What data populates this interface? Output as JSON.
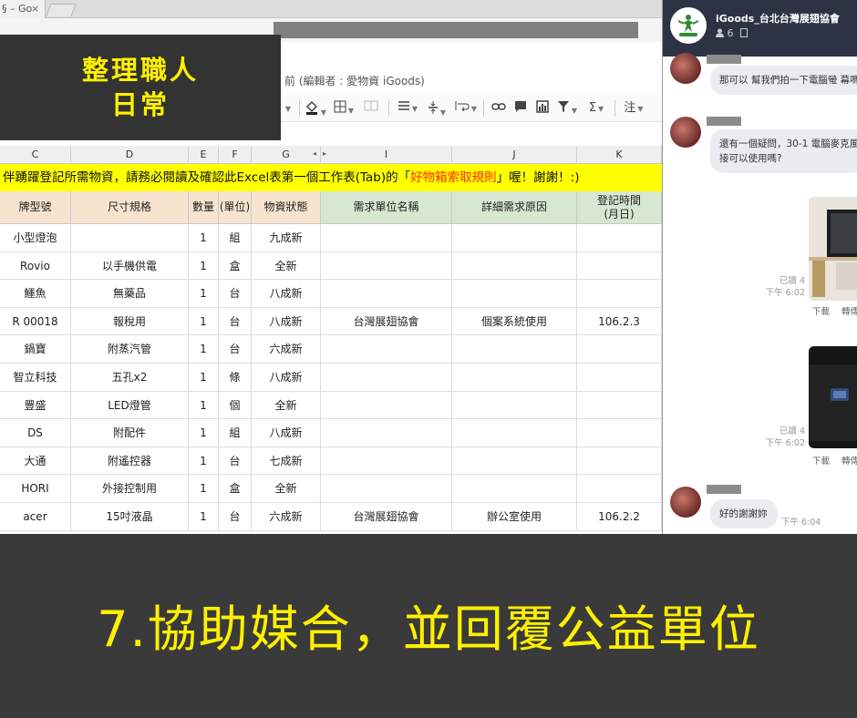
{
  "browser": {
    "tab_title": "§ – Go",
    "tab_close": "×"
  },
  "document": {
    "title_suffix": "前 (編輯者 : 愛物資 iGoods)"
  },
  "toolbar": {
    "comment_label": "注"
  },
  "overlay": {
    "line1": "整理職人",
    "line2": "日常"
  },
  "sheet": {
    "columns": [
      "C",
      "D",
      "E",
      "F",
      "G",
      "I",
      "J",
      "K"
    ],
    "notice_prefix": "伴踴躍登記所需物資，請務必閱讀及確認此Excel表第一個工作表(Tab)的「",
    "notice_highlight": "好物箱索取規則",
    "notice_suffix": "」喔！謝謝！:)",
    "headers": {
      "brand": "牌型號",
      "spec": "尺寸規格",
      "qty": "數量",
      "unit": "(單位)",
      "condition": "物資狀態",
      "org": "需求單位名稱",
      "reason": "詳細需求原因",
      "date_line1": "登記時間",
      "date_line2": "(月日)"
    },
    "rows": [
      {
        "brand": "小型燈泡",
        "spec": "",
        "qty": "1",
        "unit": "組",
        "condition": "九成新",
        "org": "",
        "reason": "",
        "date": ""
      },
      {
        "brand": "Rovio",
        "spec": "以手機供電",
        "qty": "1",
        "unit": "盒",
        "condition": "全新",
        "org": "",
        "reason": "",
        "date": ""
      },
      {
        "brand": "鱷魚",
        "spec": "無藥品",
        "qty": "1",
        "unit": "台",
        "condition": "八成新",
        "org": "",
        "reason": "",
        "date": ""
      },
      {
        "brand": "R 00018",
        "spec": "報稅用",
        "qty": "1",
        "unit": "台",
        "condition": "八成新",
        "org": "台灣展翅協會",
        "reason": "個案系統使用",
        "date": "106.2.3"
      },
      {
        "brand": "鍋寶",
        "spec": "附蒸汽管",
        "qty": "1",
        "unit": "台",
        "condition": "六成新",
        "org": "",
        "reason": "",
        "date": ""
      },
      {
        "brand": "智立科技",
        "spec": "五孔x2",
        "qty": "1",
        "unit": "條",
        "condition": "八成新",
        "org": "",
        "reason": "",
        "date": ""
      },
      {
        "brand": "豐盛",
        "spec": "LED燈管",
        "qty": "1",
        "unit": "個",
        "condition": "全新",
        "org": "",
        "reason": "",
        "date": ""
      },
      {
        "brand": "DS",
        "spec": "附配件",
        "qty": "1",
        "unit": "組",
        "condition": "八成新",
        "org": "",
        "reason": "",
        "date": ""
      },
      {
        "brand": "大通",
        "spec": "附遙控器",
        "qty": "1",
        "unit": "台",
        "condition": "七成新",
        "org": "",
        "reason": "",
        "date": ""
      },
      {
        "brand": "HORI",
        "spec": "外接控制用",
        "qty": "1",
        "unit": "盒",
        "condition": "全新",
        "org": "",
        "reason": "",
        "date": ""
      },
      {
        "brand": "acer",
        "spec": "15吋液晶",
        "qty": "1",
        "unit": "台",
        "condition": "六成新",
        "org": "台灣展翅協會",
        "reason": "辦公室使用",
        "date": "106.2.2"
      }
    ]
  },
  "chat": {
    "group_name": "iGoods_台北台灣展翅協會",
    "member_count": "6",
    "messages": [
      {
        "text": "那可以 幫我們拍一下電腦螢 幕嗎"
      },
      {
        "text": "還有一個疑問，30-1 電腦麥克風",
        "text2": "接可以使用嗎?"
      }
    ],
    "images": [
      {
        "read": "已讀 4",
        "time": "下午 6:02",
        "download": "下載",
        "forward": "轉傳"
      },
      {
        "read": "已讀 4",
        "time": "下午 6:02",
        "download": "下載",
        "forward": "轉傳"
      }
    ],
    "last_message": {
      "text": "好的謝謝妳",
      "time": "下午 6:04"
    }
  },
  "banner": {
    "text": "7.協助媒合，並回覆公益單位"
  },
  "colors": {
    "overlay_bg": "#333333",
    "accent_yellow": "#fff000",
    "notice_bg": "#ffff00",
    "notice_highlight": "#ff2a00",
    "chat_header": "#2d3244",
    "banner_bg": "#3a3a3a"
  }
}
